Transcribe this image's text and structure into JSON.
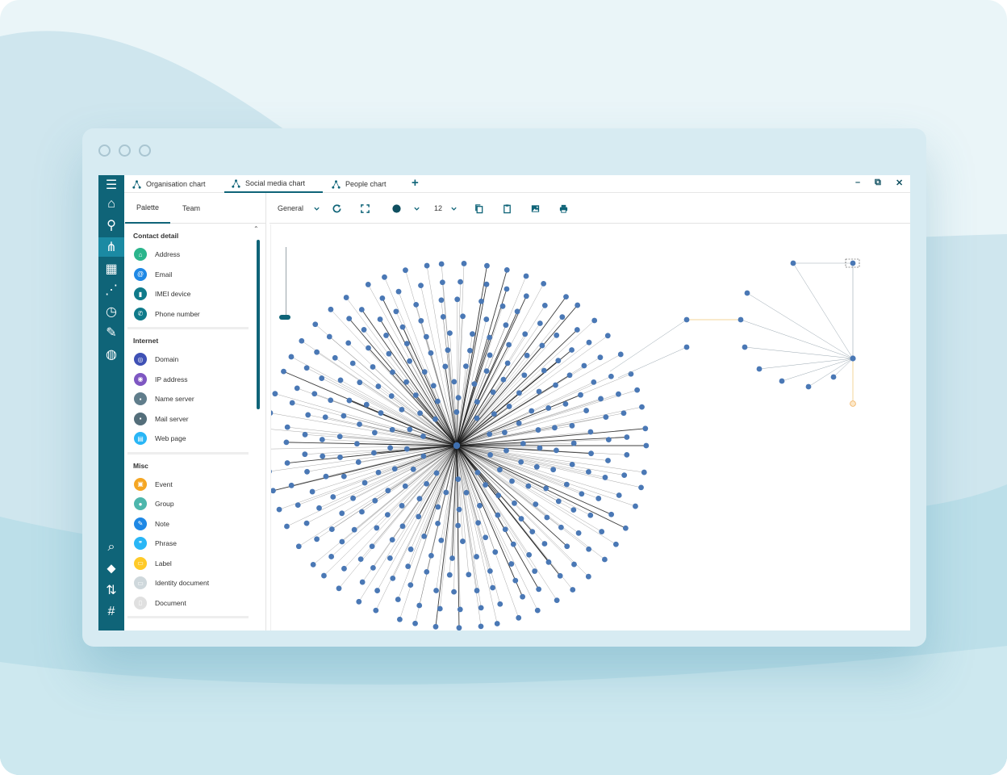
{
  "tabs": [
    {
      "label": "Organisation chart",
      "active": false
    },
    {
      "label": "Social media chart",
      "active": true
    },
    {
      "label": "People chart",
      "active": false
    }
  ],
  "tab_add_label": "+",
  "window_controls": {
    "minimize": "–",
    "restore": "⧉",
    "close": "✕"
  },
  "rail": [
    {
      "name": "menu-icon",
      "glyph": "☰"
    },
    {
      "name": "home-icon",
      "glyph": "⌂"
    },
    {
      "name": "search-icon",
      "glyph": "⚲"
    },
    {
      "name": "network-icon",
      "glyph": "⋔",
      "active": true
    },
    {
      "name": "table-icon",
      "glyph": "▦"
    },
    {
      "name": "tree-icon",
      "glyph": "⋰"
    },
    {
      "name": "clock-icon",
      "glyph": "◷"
    },
    {
      "name": "edit-document-icon",
      "glyph": "✎"
    },
    {
      "name": "globe-icon",
      "glyph": "◍"
    },
    {
      "name": "search-list-icon",
      "glyph": "⌕"
    },
    {
      "name": "tag-icon",
      "glyph": "⬥"
    },
    {
      "name": "sort-icon",
      "glyph": "⇅"
    },
    {
      "name": "hash-icon",
      "glyph": "#"
    }
  ],
  "panel": {
    "tabs": [
      {
        "label": "Palette",
        "active": true
      },
      {
        "label": "Team",
        "active": false
      }
    ],
    "sections": [
      {
        "title": "Contact detail",
        "items": [
          {
            "label": "Address",
            "icon": "address-icon",
            "color": "#2bb58c"
          },
          {
            "label": "Email",
            "icon": "email-icon",
            "color": "#1e88e5"
          },
          {
            "label": "IMEI device",
            "icon": "imei-device-icon",
            "color": "#0f7a8a"
          },
          {
            "label": "Phone number",
            "icon": "phone-icon",
            "color": "#0f7a8a"
          }
        ]
      },
      {
        "title": "Internet",
        "items": [
          {
            "label": "Domain",
            "icon": "domain-icon",
            "color": "#3f51b5"
          },
          {
            "label": "IP address",
            "icon": "ip-address-icon",
            "color": "#7e57c2"
          },
          {
            "label": "Name server",
            "icon": "name-server-icon",
            "color": "#607d8b"
          },
          {
            "label": "Mail server",
            "icon": "mail-server-icon",
            "color": "#546e7a"
          },
          {
            "label": "Web page",
            "icon": "web-page-icon",
            "color": "#29b6f6"
          }
        ]
      },
      {
        "title": "Misc",
        "items": [
          {
            "label": "Event",
            "icon": "event-icon",
            "color": "#f5a623"
          },
          {
            "label": "Group",
            "icon": "group-icon",
            "color": "#4db6ac"
          },
          {
            "label": "Note",
            "icon": "note-icon",
            "color": "#1e88e5"
          },
          {
            "label": "Phrase",
            "icon": "phrase-icon",
            "color": "#29b6f6"
          },
          {
            "label": "Label",
            "icon": "label-icon",
            "color": "#ffca28"
          },
          {
            "label": "Identity document",
            "icon": "identity-document-icon",
            "color": "#cfd8dc"
          },
          {
            "label": "Document",
            "icon": "document-icon",
            "color": "#e0e0e0"
          }
        ]
      }
    ]
  },
  "toolbar": {
    "layout_select": "General",
    "font_size": "12",
    "icons": [
      "refresh-icon",
      "fit-screen-icon",
      "node-color-icon",
      "copy-icon",
      "paste-icon",
      "export-image-icon",
      "print-icon"
    ]
  },
  "graph": {
    "node_color": "#4a78b5",
    "edge_color": "#1a1a1a",
    "highlight_edge_color": "#f3d59a",
    "hub_leaf_count": 330,
    "cluster_leaf_count": 9
  },
  "colors": {
    "accent": "#0f6478",
    "accent_light": "#1b8aa3",
    "window_bg": "#d7ebf2"
  }
}
